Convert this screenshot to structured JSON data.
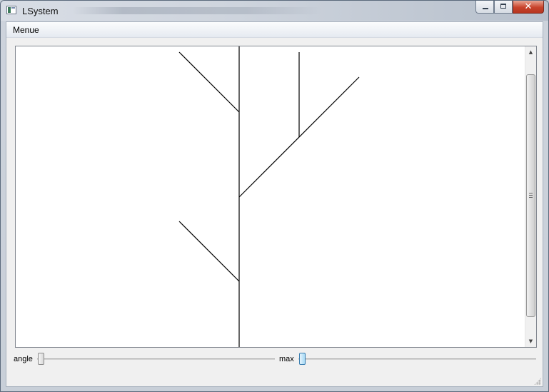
{
  "window": {
    "title": "LSystem",
    "accent": "#c8432b"
  },
  "menubar": {
    "items": [
      {
        "label": "Menue"
      }
    ]
  },
  "canvas": {
    "line_color": "#000000",
    "background": "#ffffff"
  },
  "controls": {
    "angle": {
      "label": "angle",
      "value_fraction": 0.0
    },
    "max": {
      "label": "max",
      "value_fraction": 0.0
    }
  },
  "icons": {
    "close": "✕"
  }
}
